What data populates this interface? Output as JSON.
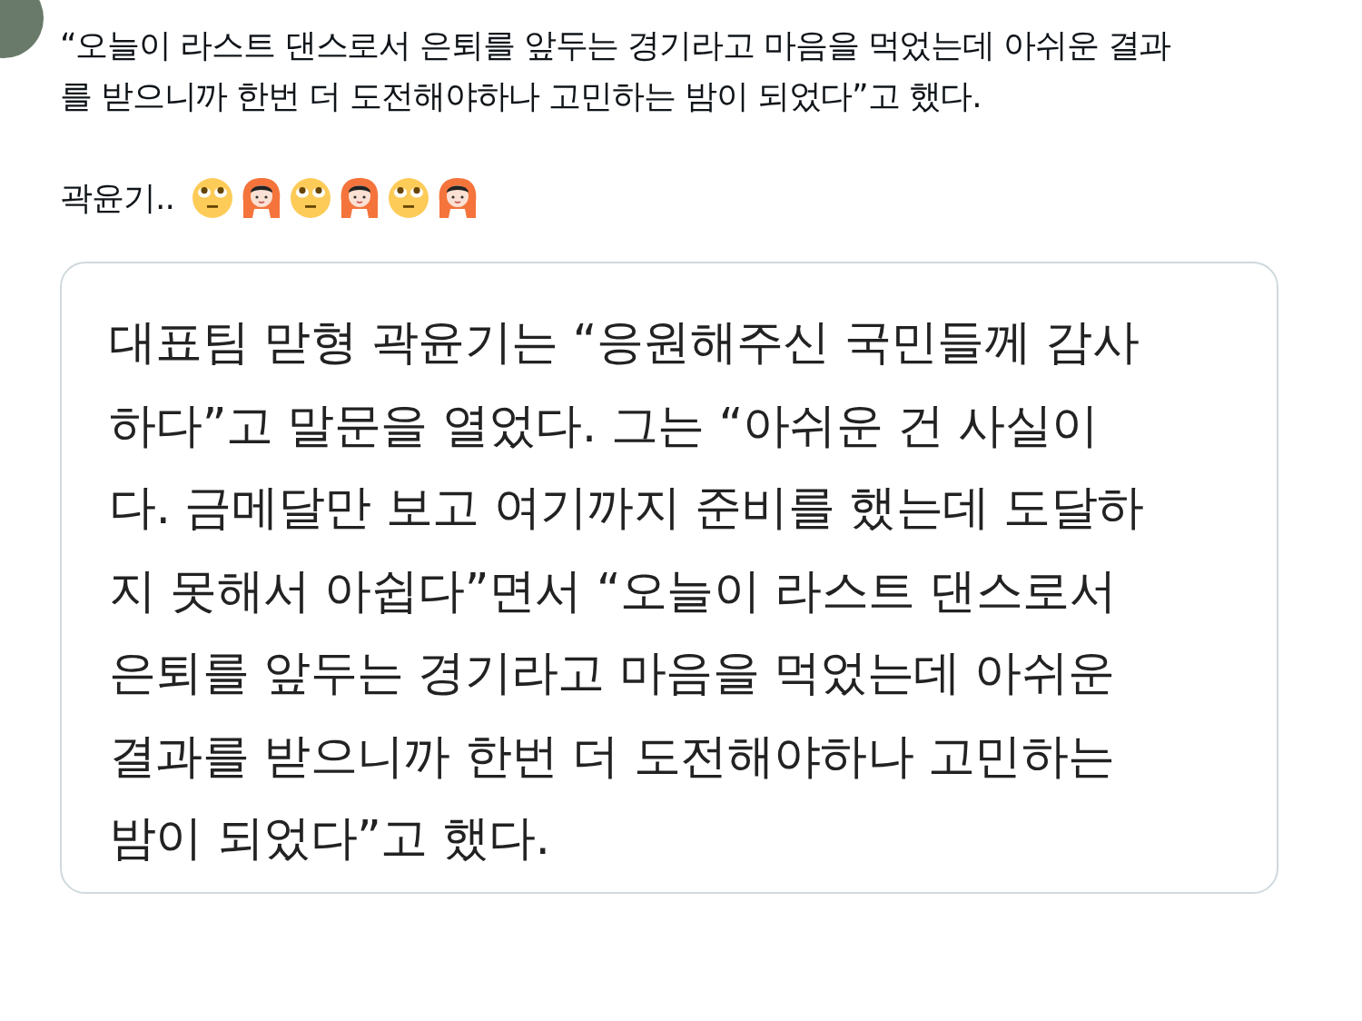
{
  "tweet": {
    "lines": [
      "“오늘이 라스트 댄스로서 은퇴를 앞두는 경기라고 마음을 먹었는데 아쉬운 결과",
      "를 받으니까 한번 더 도전해야하나 고민하는 밤이 되었다”고 했다."
    ],
    "caption": "곽윤기..",
    "emojis": [
      {
        "kind": "eye-roll"
      },
      {
        "kind": "ok-gesture"
      },
      {
        "kind": "eye-roll"
      },
      {
        "kind": "ok-gesture"
      },
      {
        "kind": "eye-roll"
      },
      {
        "kind": "ok-gesture"
      }
    ]
  },
  "quote": {
    "lines": [
      "대표팀 맏형 곽윤기는 “응원해주신 국민들께 감사",
      "하다”고 말문을 열었다. 그는 “아쉬운 건 사실이",
      "다. 금메달만 보고 여기까지 준비를 했는데 도달하",
      "지 못해서 아쉽다”면서 “오늘이 라스트 댄스로서",
      "은퇴를 앞두는 경기라고 마음을 먹었는데 아쉬운",
      "결과를 받으니까 한번 더 도전해야하나 고민하는",
      "밤이 되었다”고 했다."
    ]
  }
}
